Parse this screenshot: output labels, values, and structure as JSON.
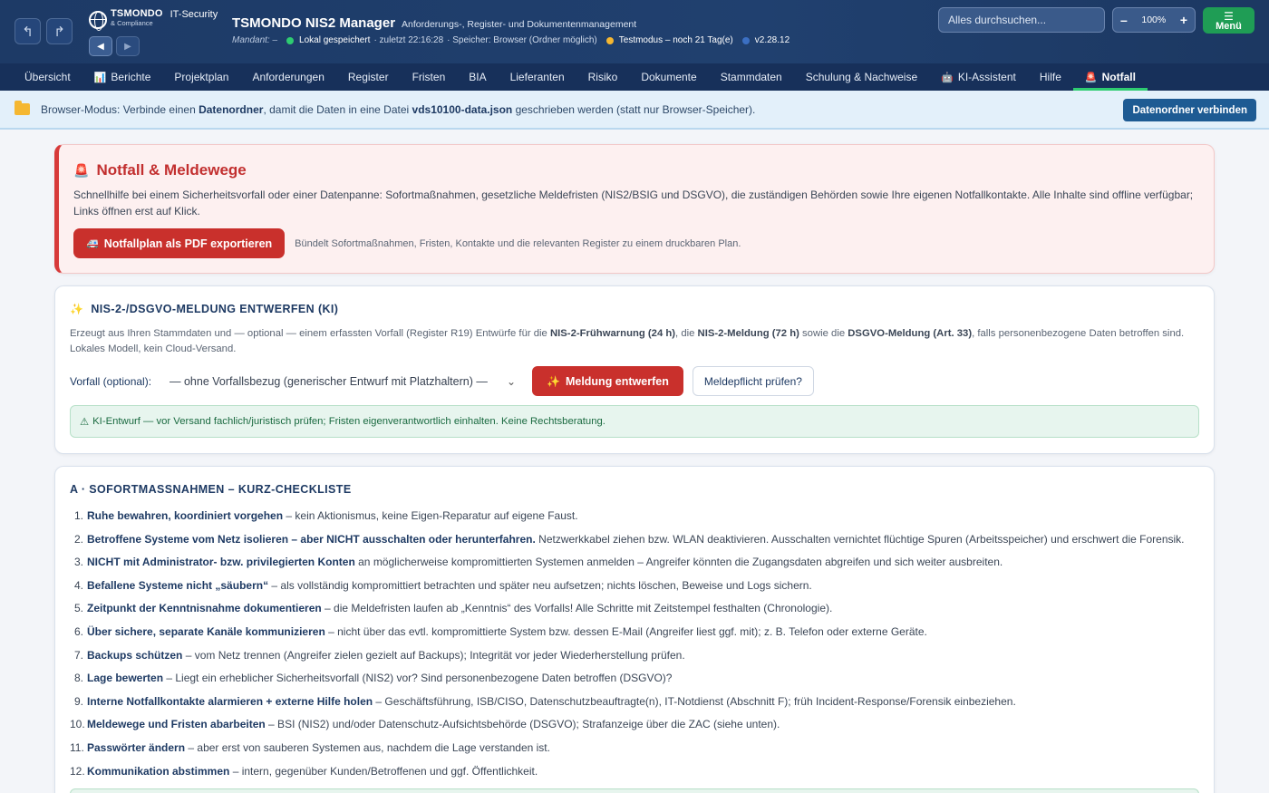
{
  "header": {
    "undo_icon": "↰",
    "redo_icon": "↱",
    "logo_brand": "TSMONDO",
    "logo_sub": "& Compliance",
    "logo_it": "IT-Security",
    "back_icon": "◀",
    "forward_icon": "▶",
    "app_title": "TSMONDO NIS2 Manager",
    "app_subtitle": "Anforderungs-, Register- und Dokumentenmanagement",
    "mandant": "Mandant: –",
    "status_saved": "Lokal gespeichert",
    "status_last": "· zuletzt 22:16:28",
    "status_storage": "· Speicher: Browser (Ordner möglich)",
    "status_test": "Testmodus – noch 21 Tag(e)",
    "version": "v2.28.12",
    "search_placeholder": "Alles durchsuchen...",
    "zoom_minus": "–",
    "zoom_value": "100%",
    "zoom_plus": "+",
    "menu_icon": "☰",
    "menu_label": "Menü",
    "colors": {
      "saved": "#2ecc71",
      "test": "#f5b731",
      "version": "#3b6fc2"
    }
  },
  "tabs": [
    {
      "label": "Übersicht",
      "icon": ""
    },
    {
      "label": "Berichte",
      "icon": "📊"
    },
    {
      "label": "Projektplan",
      "icon": ""
    },
    {
      "label": "Anforderungen",
      "icon": ""
    },
    {
      "label": "Register",
      "icon": ""
    },
    {
      "label": "Fristen",
      "icon": ""
    },
    {
      "label": "BIA",
      "icon": ""
    },
    {
      "label": "Lieferanten",
      "icon": ""
    },
    {
      "label": "Risiko",
      "icon": ""
    },
    {
      "label": "Dokumente",
      "icon": ""
    },
    {
      "label": "Stammdaten",
      "icon": ""
    },
    {
      "label": "Schulung & Nachweise",
      "icon": ""
    },
    {
      "label": "KI-Assistent",
      "icon": "🤖"
    },
    {
      "label": "Hilfe",
      "icon": ""
    },
    {
      "label": "Notfall",
      "icon": "🚨"
    }
  ],
  "infobar": {
    "text_1": "Browser-Modus: Verbinde einen ",
    "bold_1": "Datenordner",
    "text_2": ", damit die Daten in eine Datei ",
    "bold_2": "vds10100-data.json",
    "text_3": " geschrieben werden (statt nur Browser-Speicher).",
    "button": "Datenordner verbinden"
  },
  "alert": {
    "icon": "🚨",
    "title": "Notfall & Meldewege",
    "description": "Schnellhilfe bei einem Sicherheitsvorfall oder einer Datenpanne: Sofortmaßnahmen, gesetzliche Meldefristen (NIS2/BSIG und DSGVO), die zuständigen Behörden sowie Ihre eigenen Notfallkontakte. Alle Inhalte sind offline verfügbar; Links öffnen erst auf Klick.",
    "export_icon": "🚑",
    "export_button": "Notfallplan als PDF exportieren",
    "export_hint": "Bündelt Sofortmaßnahmen, Fristen, Kontakte und die relevanten Register zu einem druckbaren Plan."
  },
  "ki": {
    "icon": "✨",
    "title": "NIS-2-/DSGVO-MELDUNG ENTWERFEN (KI)",
    "desc_1": "Erzeugt aus Ihren Stammdaten und — optional — einem erfassten Vorfall (Register R19) Entwürfe für die ",
    "desc_b1": "NIS-2-Frühwarnung (24 h)",
    "desc_2": ", die ",
    "desc_b2": "NIS-2-Meldung (72 h)",
    "desc_3": " sowie die ",
    "desc_b3": "DSGVO-Meldung (Art. 33)",
    "desc_4": ", falls personenbezogene Daten betroffen sind. Lokales Modell, kein Cloud-Versand.",
    "incident_label": "Vorfall (optional):",
    "incident_value": "— ohne Vorfallsbezug (generischer Entwurf mit Platzhaltern) —",
    "draft_button": "Meldung entwerfen",
    "check_button": "Meldepflicht prüfen?",
    "note_icon": "⚠",
    "note": "KI-Entwurf — vor Versand fachlich/juristisch prüfen; Fristen eigenverantwortlich einhalten. Keine Rechtsberatung."
  },
  "checklist": {
    "title": "A · SOFORTMASSNAHMEN – KURZ-CHECKLISTE",
    "items": [
      {
        "n": "1.",
        "bold": "Ruhe bewahren, koordiniert vorgehen",
        "text": " – kein Aktionismus, keine Eigen-Reparatur auf eigene Faust."
      },
      {
        "n": "2.",
        "bold": "Betroffene Systeme vom Netz isolieren – aber NICHT ausschalten oder herunterfahren.",
        "text": " Netzwerkkabel ziehen bzw. WLAN deaktivieren. Ausschalten vernichtet flüchtige Spuren (Arbeitsspeicher) und erschwert die Forensik."
      },
      {
        "n": "3.",
        "bold": "NICHT mit Administrator- bzw. privilegierten Konten",
        "text": " an möglicherweise kompromittierten Systemen anmelden – Angreifer könnten die Zugangsdaten abgreifen und sich weiter ausbreiten."
      },
      {
        "n": "4.",
        "bold": "Befallene Systeme nicht „säubern“",
        "text": " – als vollständig kompromittiert betrachten und später neu aufsetzen; nichts löschen, Beweise und Logs sichern."
      },
      {
        "n": "5.",
        "bold": "Zeitpunkt der Kenntnisnahme dokumentieren",
        "text": " – die Meldefristen laufen ab „Kenntnis“ des Vorfalls! Alle Schritte mit Zeitstempel festhalten (Chronologie)."
      },
      {
        "n": "6.",
        "bold": "Über sichere, separate Kanäle kommunizieren",
        "text": " – nicht über das evtl. kompromittierte System bzw. dessen E-Mail (Angreifer liest ggf. mit); z. B. Telefon oder externe Geräte."
      },
      {
        "n": "7.",
        "bold": "Backups schützen",
        "text": " – vom Netz trennen (Angreifer zielen gezielt auf Backups); Integrität vor jeder Wiederherstellung prüfen."
      },
      {
        "n": "8.",
        "bold": "Lage bewerten",
        "text": " – Liegt ein erheblicher Sicherheitsvorfall (NIS2) vor? Sind personenbezogene Daten betroffen (DSGVO)?"
      },
      {
        "n": "9.",
        "bold": "Interne Notfallkontakte alarmieren + externe Hilfe holen",
        "text": " – Geschäftsführung, ISB/CISO, Datenschutzbeauftragte(n), IT-Notdienst (Abschnitt F); früh Incident-Response/Forensik einbeziehen."
      },
      {
        "n": "10.",
        "bold": "Meldewege und Fristen abarbeiten",
        "text": " – BSI (NIS2) und/oder Datenschutz-Aufsichtsbehörde (DSGVO); Strafanzeige über die ZAC (siehe unten)."
      },
      {
        "n": "11.",
        "bold": "Passwörter ändern",
        "text": " – aber erst von sauberen Systemen aus, nachdem die Lage verstanden ist."
      },
      {
        "n": "12.",
        "bold": "Kommunikation abstimmen",
        "text": " – intern, gegenüber Kunden/Betroffenen und ggf. Öffentlichkeit."
      }
    ]
  }
}
